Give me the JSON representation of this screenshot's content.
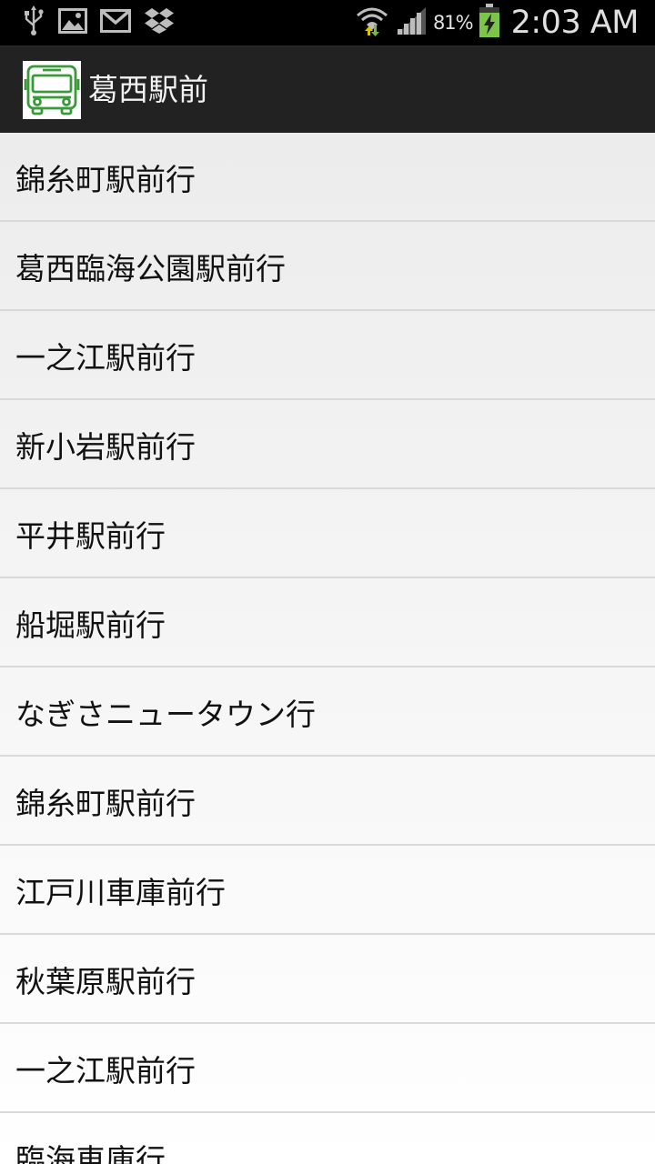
{
  "status_bar": {
    "icons_left": [
      "usb-icon",
      "image-icon",
      "gmail-icon",
      "dropbox-icon"
    ],
    "icons_right": [
      "wifi-icon",
      "signal-icon",
      "battery-charging-icon"
    ],
    "battery_percent": "81%",
    "time": "2:03 AM"
  },
  "action_bar": {
    "icon": "bus-icon",
    "title": "葛西駅前",
    "accent_color": "#3a9a3a"
  },
  "destinations": [
    "錦糸町駅前行",
    "葛西臨海公園駅前行",
    "一之江駅前行",
    "新小岩駅前行",
    "平井駅前行",
    "船堀駅前行",
    "なぎさニュータウン行",
    "錦糸町駅前行",
    "江戸川車庫前行",
    "秋葉原駅前行",
    "一之江駅前行",
    "臨海車庫行"
  ]
}
